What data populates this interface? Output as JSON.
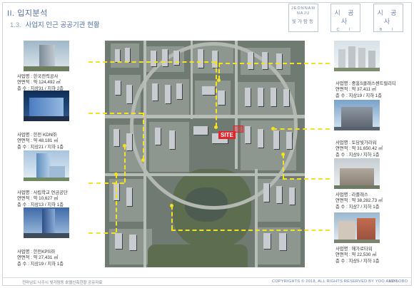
{
  "header": {
    "section_title": "II. 입지분석",
    "sub_number": "1.3.",
    "sub_title": "사업지 인근 공공기관 현황"
  },
  "logos": {
    "logo1_line1": "JEONNAM",
    "logo1_line2": "NAJU",
    "logo1_kr": "빛가람동",
    "logo2_big": "시 공 사",
    "logo2_small": "C I",
    "logo3_big": "시 공 사",
    "logo3_small": "B I"
  },
  "map": {
    "site_label": "SITE"
  },
  "buildings": [
    {
      "side": "left",
      "name": "사업명 : 한국전력공사",
      "area": "연면적 : 약 124,492 ㎡",
      "floors": "층 수 : 지상31 / 지하 2층"
    },
    {
      "side": "left",
      "name": "사업명 : 한전 KDN㈜",
      "area": "연면적 : 약 48,181 ㎡",
      "floors": "층 수 : 지상21 / 지하 1층"
    },
    {
      "side": "left",
      "name": "사업명 : 사립학교 연금공단",
      "area": "연면적 : 약 10,627 ㎡",
      "floors": "층 수 : 지상13 / 지하 1층"
    },
    {
      "side": "left",
      "name": "사업명 : 한전KPS㈜",
      "area": "연면적 : 약 27,431 ㎡",
      "floors": "층 수 : 지상19 / 지하 1층"
    },
    {
      "side": "right",
      "name": "사업명 : 중흥S클래스센트럴리티",
      "area": "연면적 : 약 37,411 ㎡",
      "floors": "층 수 : 지상19 / 지하 1층"
    },
    {
      "side": "right",
      "name": "사업명 : 토담빛가라워",
      "area": "연면적 : 약 31,650.42 ㎡",
      "floors": "층 수 : 지상9 / 지하 1층"
    },
    {
      "side": "right",
      "name": "사업명 : 라플래스",
      "area": "연면적 : 약 38,282.73 ㎡",
      "floors": "층 수 : 지상7 / 지하 1층"
    },
    {
      "side": "right",
      "name": "사업명 : 에가로타워",
      "area": "연면적 : 약 22,530 ㎡",
      "floors": "층 수 : 지상5 / 지하 1층"
    }
  ],
  "footer": {
    "left": "전라남도 나주시 빛가람동 호텔신축현황 공유자료",
    "right": "COPYRIGHTS © 2018, ALL RIGHTS RESERVED BY YOO AND LOBO",
    "page": "18/45"
  },
  "colors": {
    "accent": "#4f6fa3",
    "connector": "#f4e120",
    "site": "#e0262b"
  }
}
